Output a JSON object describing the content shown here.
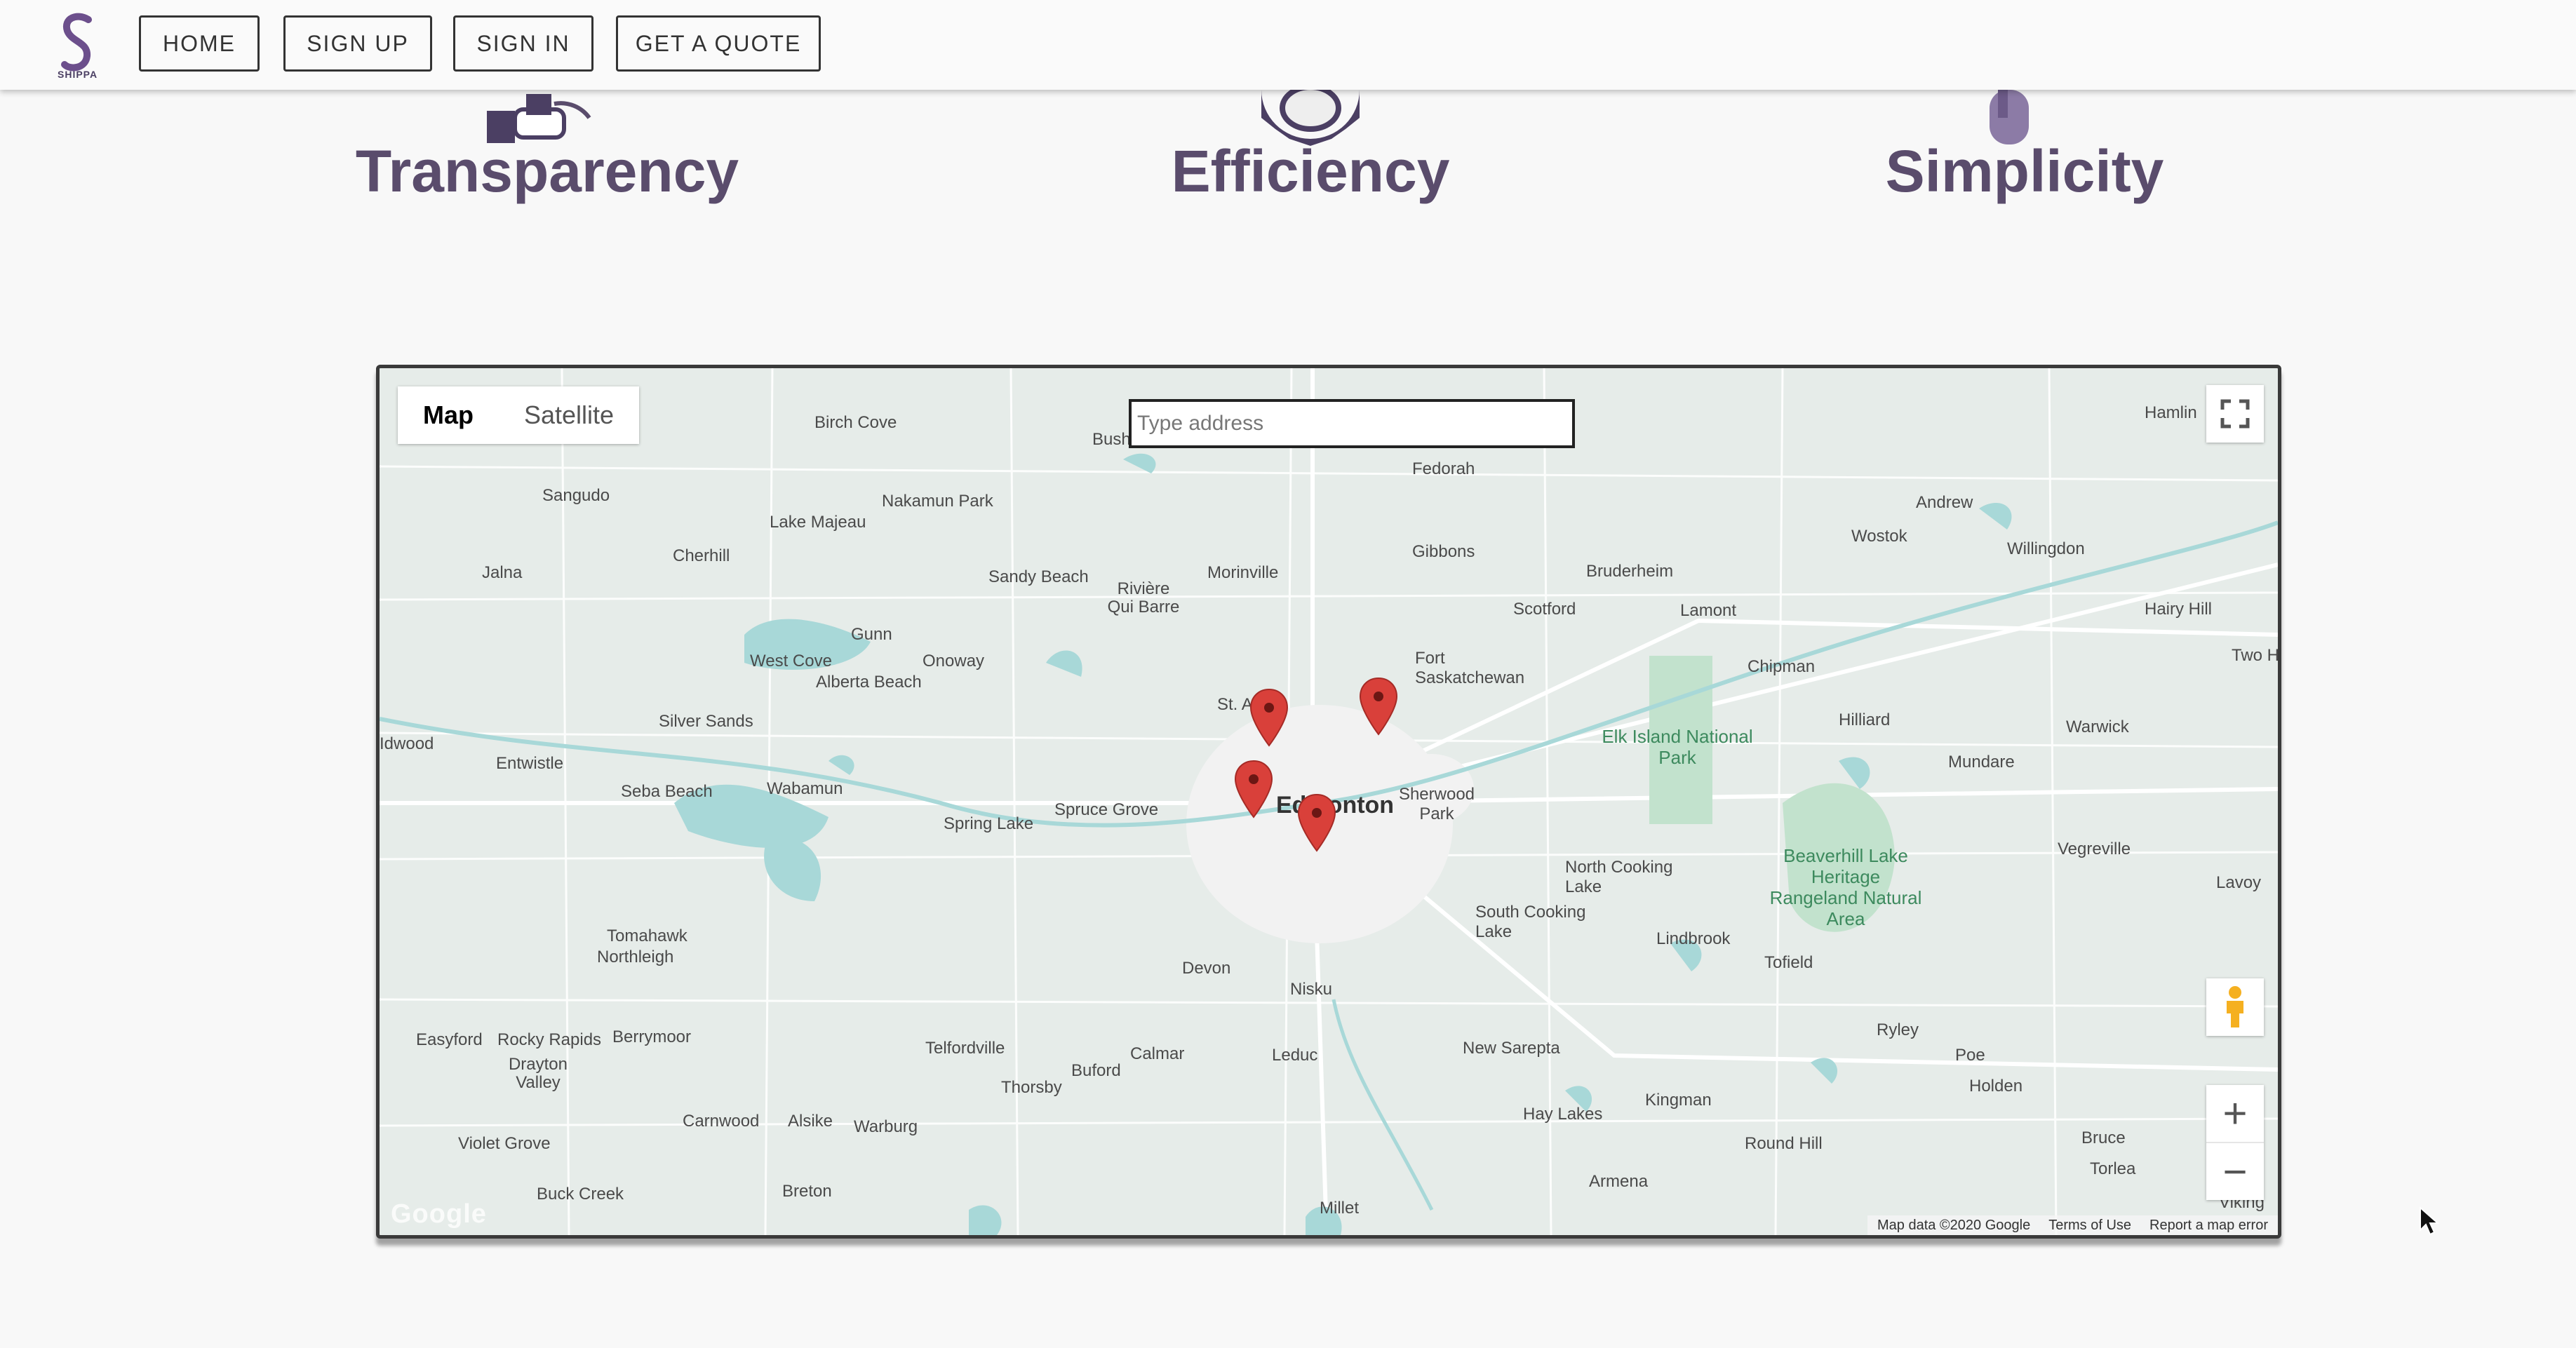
{
  "nav": {
    "logo_text": "SHIPPA",
    "buttons": [
      "HOME",
      "SIGN UP",
      "SIGN IN",
      "GET A QUOTE"
    ]
  },
  "features": [
    {
      "title": "Transparency",
      "icon": "handshake-icon"
    },
    {
      "title": "Efficiency",
      "icon": "gear-icon"
    },
    {
      "title": "Simplicity",
      "icon": "pointer-hand-icon"
    }
  ],
  "map": {
    "map_type": {
      "map": "Map",
      "satellite": "Satellite",
      "selected": "Map"
    },
    "search": {
      "placeholder": "Type address",
      "value": ""
    },
    "labels": {
      "birch_cove": "Birch Cove",
      "busby": "Bush",
      "fedorah": "Fedorah",
      "hamlin": "Hamlin",
      "sangudo": "Sangudo",
      "nakamun_park": "Nakamun Park",
      "lake_majeau": "Lake Majeau",
      "andrew": "Andrew",
      "wostok": "Wostok",
      "willingdon": "Willingdon",
      "cherhill": "Cherhill",
      "gibbons": "Gibbons",
      "jalna": "Jalna",
      "sandy_beach": "Sandy Beach",
      "riviere_qui_barre": "Rivière Qui Barre",
      "morinville": "Morinville",
      "bruderheim": "Bruderheim",
      "scotford": "Scotford",
      "lamont": "Lamont",
      "hairy_hill": "Hairy Hill",
      "gunn": "Gunn",
      "west_cove": "West Cove",
      "alberta_beach": "Alberta Beach",
      "onoway": "Onoway",
      "fort_saskatchewan": "Fort Saskatchewan",
      "chipman": "Chipman",
      "two_hills": "Two Hills",
      "st_albert": "St. Albert",
      "silver_sands": "Silver Sands",
      "hilliard": "Hilliard",
      "warwick": "Warwick",
      "idwood": "Idwood",
      "entwistle": "Entwistle",
      "elk_island": "Elk Island National Park",
      "mundare": "Mundare",
      "seba_beach": "Seba Beach",
      "wabamun": "Wabamun",
      "spruce_grove": "Spruce Grove",
      "edmonton": "Edmonton",
      "sherwood_park": "Sherwood Park",
      "spring_lake": "Spring Lake",
      "beaverhill": "Beaverhill Lake Heritage Rangeland Natural Area",
      "vegreville": "Vegreville",
      "north_cooking_lake": "North Cooking Lake",
      "lavoy": "Lavoy",
      "south_cooking_lake": "South Cooking Lake",
      "tomahawk": "Tomahawk",
      "northleigh": "Northleigh",
      "lindbrook": "Lindbrook",
      "tofield": "Tofield",
      "devon": "Devon",
      "nisku": "Nisku",
      "ryley": "Ryley",
      "poe": "Poe",
      "easyford": "Easyford",
      "rocky_rapids": "Rocky Rapids",
      "berrymoor": "Berrymoor",
      "telfordville": "Telfordville",
      "calmar": "Calmar",
      "leduc": "Leduc",
      "new_sarepta": "New Sarepta",
      "holden": "Holden",
      "drayton_valley": "Drayton Valley",
      "buford": "Buford",
      "thorsby": "Thorsby",
      "kingman": "Kingman",
      "carnwood": "Carnwood",
      "alsike": "Alsike",
      "warburg": "Warburg",
      "hay_lakes": "Hay Lakes",
      "bruce": "Bruce",
      "violet_grove": "Violet Grove",
      "round_hill": "Round Hill",
      "torlea": "Torlea",
      "buck_creek": "Buck Creek",
      "breton": "Breton",
      "armena": "Armena",
      "millet": "Millet",
      "viking": "Viking"
    },
    "google_logo": "Google",
    "footer": {
      "map_data": "Map data ©2020 Google",
      "terms": "Terms of Use",
      "report": "Report a map error"
    },
    "zoom_in": "+",
    "zoom_out": "−",
    "marker_color": "#d9403a",
    "water_color": "#a8d8d8",
    "park_color": "#c2e2cd"
  }
}
